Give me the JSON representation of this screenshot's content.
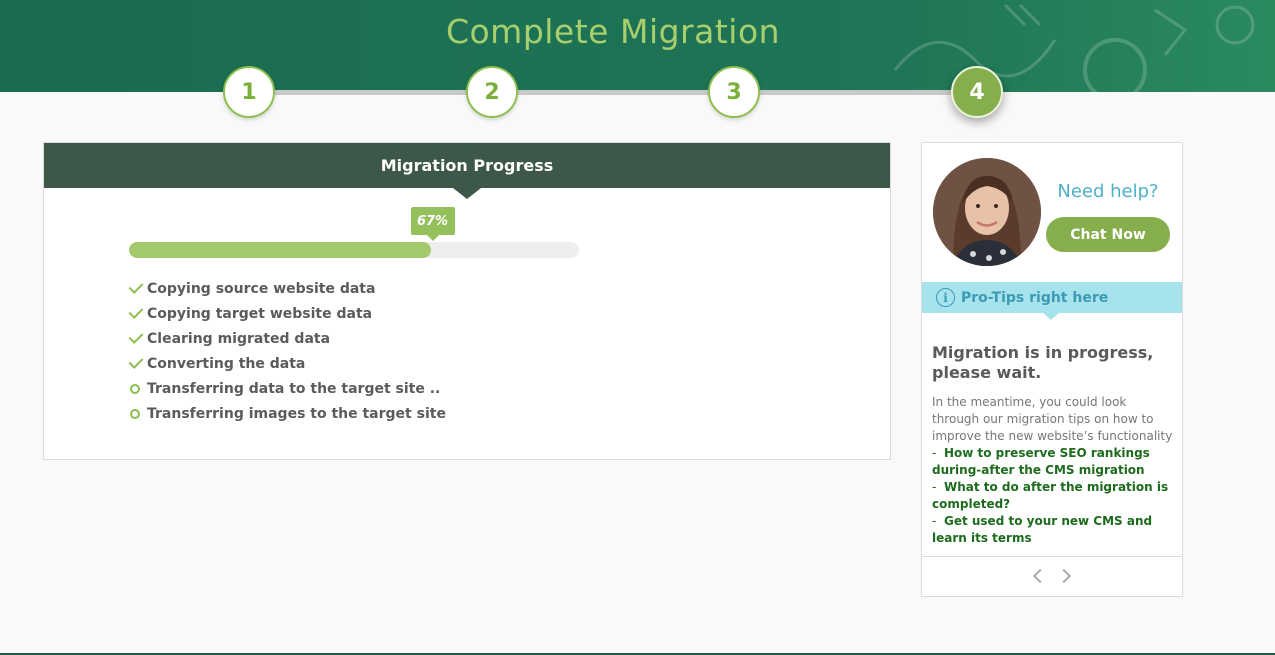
{
  "header": {
    "title": "Complete Migration",
    "steps": [
      {
        "label": "1",
        "active": false
      },
      {
        "label": "2",
        "active": false
      },
      {
        "label": "3",
        "active": false
      },
      {
        "label": "4",
        "active": true
      }
    ]
  },
  "progress_panel": {
    "title": "Migration Progress",
    "percent_label": "67%",
    "progress": 0.67,
    "tasks": [
      {
        "label": "Copying source website data",
        "status": "done"
      },
      {
        "label": "Copying target website data",
        "status": "done"
      },
      {
        "label": "Clearing migrated data",
        "status": "done"
      },
      {
        "label": "Converting the data",
        "status": "done"
      },
      {
        "label": "Transferring data to the target site ..",
        "status": "pending"
      },
      {
        "label": "Transferring images to the target site",
        "status": "pending"
      }
    ]
  },
  "sidebar": {
    "need_help": "Need help?",
    "chat_button": "Chat Now",
    "tips_header": "Pro-Tips right here",
    "tip_title": "Migration is in progress, please wait.",
    "tip_body": "In the meantime, you could look through our migration tips on how to improve the new website’s functionality",
    "tip_links": [
      "How to preserve SEO rankings during-after the CMS migration",
      "What to do after the migration is completed?",
      "Get used to your new CMS and learn its terms"
    ]
  },
  "colors": {
    "header_green": "#1d7154",
    "accent_green": "#86ae4c",
    "progress_green": "#a3c96d",
    "panel_header": "#3d5849",
    "help_blue": "#4eb0c9",
    "tips_bg": "#a6e3ec",
    "link_green": "#1d6b1d"
  }
}
